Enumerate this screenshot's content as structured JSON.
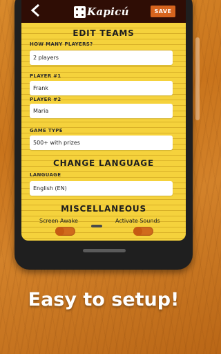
{
  "header": {
    "back_icon": "back-arrow-icon",
    "logo_text": "Kapicú",
    "save_label": "SAVE"
  },
  "edit_teams": {
    "title": "EDIT TEAMS",
    "players_label": "HOW MANY PLAYERS?",
    "players_value": "2 players",
    "player1_label": "PLAYER #1",
    "player1_value": "Frank",
    "player2_label": "PLAYER #2",
    "player2_value": "Maria",
    "game_type_label": "GAME TYPE",
    "game_type_value": "500+ with prizes"
  },
  "language": {
    "title": "CHANGE LANGUAGE",
    "label": "LANGUAGE",
    "value": "English (EN)"
  },
  "misc": {
    "title": "MISCELLANEOUS",
    "screen_awake_label": "Screen Awake",
    "activate_sounds_label": "Activate Sounds"
  },
  "tagline": "Easy to setup!",
  "colors": {
    "appbar": "#2f0d05",
    "paper": "#f5d23c",
    "accent": "#d7641e"
  }
}
